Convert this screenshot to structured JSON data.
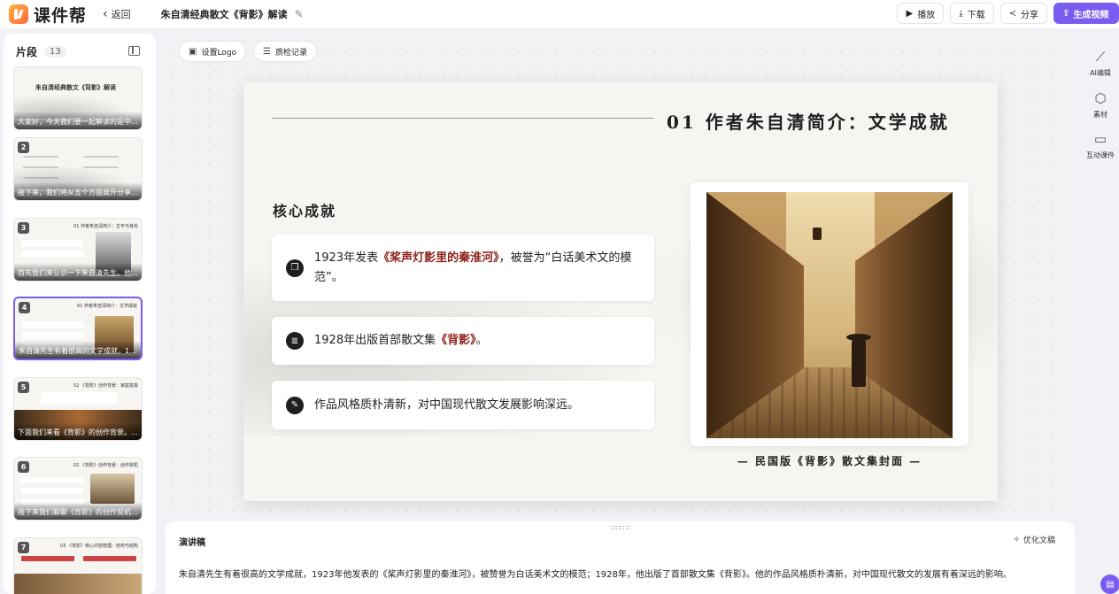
{
  "app": {
    "name": "课件帮",
    "back_label": "返回",
    "doc_title": "朱自清经典散文《背影》解读"
  },
  "toolbar": {
    "play_label": "播放",
    "download_label": "下载",
    "share_label": "分享",
    "generate_label": "生成视频",
    "accent_color": "#7b5cf0"
  },
  "sidebar": {
    "title": "片段",
    "count": "13",
    "thumbs": [
      {
        "num": "1",
        "heading": "朱自清经典散文《背影》解读",
        "caption": "大家好，今天我们要一起解读的是中国…"
      },
      {
        "num": "2",
        "heading": "",
        "caption": "接下来，我们将从五个方面展开分享。…"
      },
      {
        "num": "3",
        "heading": "01 作者朱自清简介：生平与身份",
        "caption": "首先我们来认识一下朱自清先生。他出…"
      },
      {
        "num": "4",
        "heading": "01 作者朱自清简介：文学成就",
        "caption": "朱自清先生有着很高的文学成就，1923…"
      },
      {
        "num": "5",
        "heading": "02 《背影》创作背景：家庭变故",
        "caption": "下面我们来看《背影》的创作背景。19…"
      },
      {
        "num": "6",
        "heading": "02 《背影》创作背景：创作契机",
        "caption": "接下来我们聊聊《背影》的创作契机。…"
      },
      {
        "num": "7",
        "heading": "03 《背影》核心内容梳理：结构与结构",
        "caption": ""
      }
    ]
  },
  "canvas": {
    "logo_button": "设置Logo",
    "qc_button": "质检记录"
  },
  "slide": {
    "title": "01  作者朱自清简介：文学成就",
    "subheading": "核心成就",
    "items": [
      {
        "pre": "1923年发表",
        "highlight": "《桨声灯影里的秦淮河》",
        "post": "，被誉为“白话美术文的模范”。",
        "icon": "book-icon"
      },
      {
        "pre": "1928年出版首部散文集",
        "highlight": "《背影》",
        "post": "。",
        "icon": "document-icon"
      },
      {
        "pre": "作品风格质朴清新，对中国现代散文发展影响深远。",
        "highlight": "",
        "post": "",
        "icon": "feather-icon"
      }
    ],
    "image_caption": "— 民国版《背影》散文集封面 —"
  },
  "right_tools": [
    {
      "label": "AI编辑",
      "icon": "magic-wand-icon"
    },
    {
      "label": "素材",
      "icon": "cube-icon"
    },
    {
      "label": "互动课件",
      "icon": "play-screen-icon"
    }
  ],
  "speech": {
    "title": "演讲稿",
    "optimize_label": "优化文稿",
    "text": "朱自清先生有着很高的文学成就，1923年他发表的《桨声灯影里的秦淮河》，被赞誉为白话美术文的模范；1928年，他出版了首部散文集《背影》。他的作品风格质朴清新，对中国现代散文的发展有着深远的影响。"
  }
}
